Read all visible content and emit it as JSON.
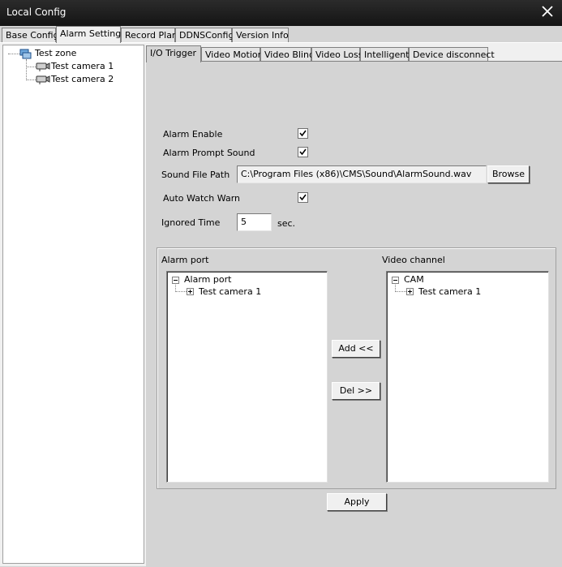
{
  "window": {
    "title": "Local Config"
  },
  "main_tabs": {
    "base_config": "Base Config",
    "alarm_setting": "Alarm Setting",
    "record_plan": "Record Plan",
    "ddns_config": "DDNSConfig",
    "version_info": "Version Info"
  },
  "tree": {
    "zone": "Test zone",
    "cameras": [
      "Test camera 1",
      "Test camera 2"
    ]
  },
  "sub_tabs": {
    "io_trigger": "I/O Trigger",
    "video_motion": "Video Motion",
    "video_blind": "Video Blind",
    "video_loss": "Video Loss",
    "intelligent": "Intelligent",
    "device_disconnect": "Device disconnect"
  },
  "form": {
    "alarm_enable_label": "Alarm Enable",
    "alarm_enable_checked": true,
    "alarm_prompt_label": "Alarm Prompt Sound",
    "alarm_prompt_checked": true,
    "sound_file_label": "Sound File Path",
    "sound_file_value": "C:\\Program Files (x86)\\CMS\\Sound\\AlarmSound.wav",
    "browse_label": "Browse",
    "auto_watch_label": "Auto Watch Warn",
    "auto_watch_checked": true,
    "ignored_time_label": "Ignored Time",
    "ignored_time_value": "5",
    "ignored_time_unit": "sec."
  },
  "alarm_port": {
    "label": "Alarm port",
    "root": "Alarm port",
    "child": "Test camera 1"
  },
  "video_channel": {
    "label": "Video channel",
    "root": "CAM",
    "child": "Test camera 1"
  },
  "buttons": {
    "add": "Add <<",
    "del": "Del >>",
    "apply": "Apply"
  }
}
